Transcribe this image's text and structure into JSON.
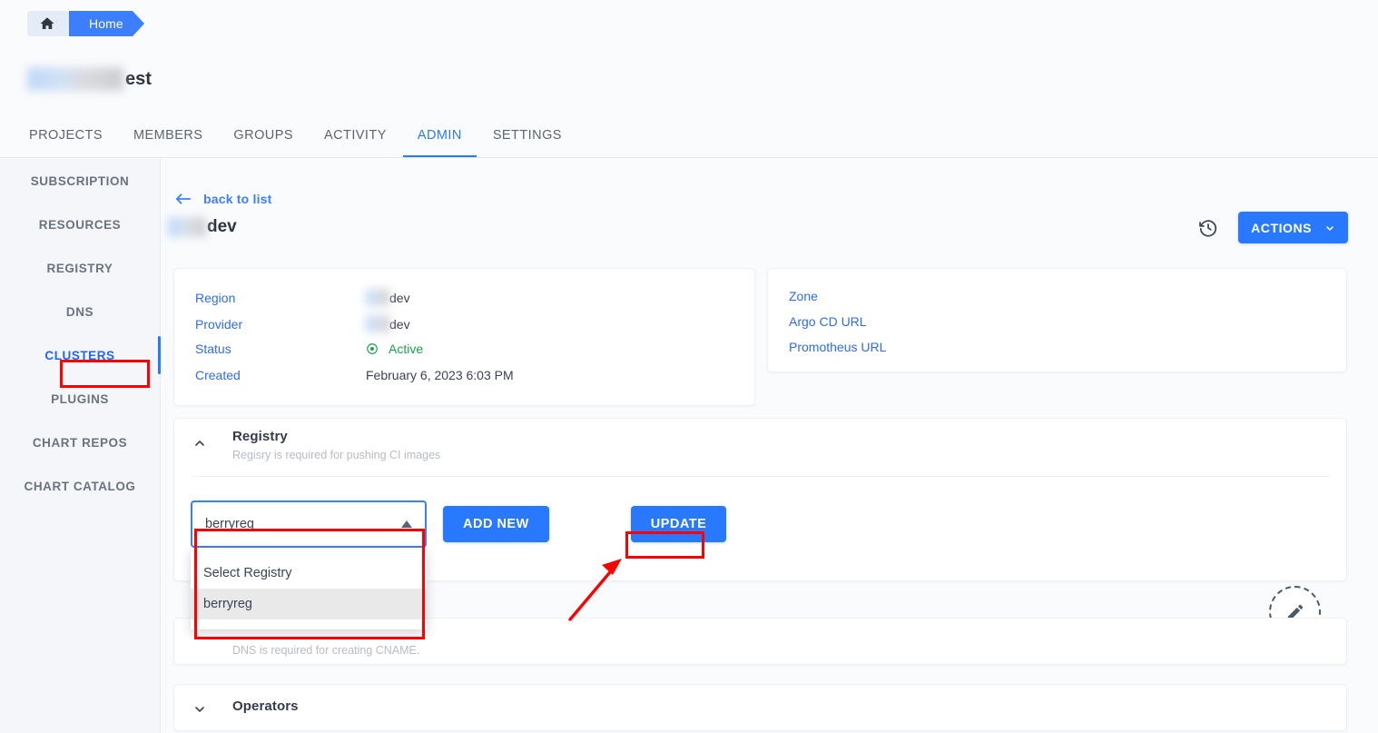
{
  "breadcrumb": {
    "home_icon": "home-icon",
    "label": "Home"
  },
  "org": {
    "title_suffix": "est",
    "redacted": true
  },
  "header": {
    "actions_label": "ACTIONS",
    "chevron": "chevron-down-icon"
  },
  "tabs": [
    {
      "label": "PROJECTS",
      "active": false
    },
    {
      "label": "MEMBERS",
      "active": false
    },
    {
      "label": "GROUPS",
      "active": false
    },
    {
      "label": "ACTIVITY",
      "active": false
    },
    {
      "label": "ADMIN",
      "active": true
    },
    {
      "label": "SETTINGS",
      "active": false
    }
  ],
  "sidebar": {
    "items": [
      {
        "label": "SUBSCRIPTION",
        "active": false
      },
      {
        "label": "RESOURCES",
        "active": false
      },
      {
        "label": "REGISTRY",
        "active": false
      },
      {
        "label": "DNS",
        "active": false
      },
      {
        "label": "CLUSTERS",
        "active": true
      },
      {
        "label": "PLUGINS",
        "active": false
      },
      {
        "label": "CHART REPOS",
        "active": false
      },
      {
        "label": "CHART CATALOG",
        "active": false
      }
    ]
  },
  "detail": {
    "back_label": "back to list",
    "back_icon": "arrow-left-icon",
    "title_suffix": "dev",
    "history_icon": "history-icon",
    "actions_label": "ACTIONS"
  },
  "info_left": {
    "rows": [
      {
        "label": "Region",
        "value": "dev",
        "redacted": true
      },
      {
        "label": "Provider",
        "value": "dev",
        "redacted": true
      },
      {
        "label": "Status",
        "value": "Active",
        "icon": "status-active-icon"
      },
      {
        "label": "Created",
        "value": "February 6, 2023 6:03 PM"
      }
    ]
  },
  "info_right": {
    "links": [
      "Zone",
      "Argo CD URL",
      "Promotheus URL"
    ]
  },
  "registry_panel": {
    "title": "Registry",
    "subtitle": "Regisry is required for pushing CI images",
    "chevron": "chevron-up-icon",
    "select": {
      "value": "berryreg",
      "caret": "caret-up-icon",
      "open": true,
      "options": [
        {
          "label": "Select Registry",
          "selected": false
        },
        {
          "label": "berryreg",
          "selected": true
        }
      ]
    },
    "add_new_label": "ADD NEW",
    "update_label": "UPDATE",
    "edit_icon": "pencil-edit-icon"
  },
  "dns_panel": {
    "subtitle": "DNS is required for creating CNAME."
  },
  "operators_panel": {
    "title": "Operators",
    "chevron": "chevron-down-icon"
  },
  "annotations": {
    "boxes": [
      "clusters-highlight",
      "registry-select-highlight",
      "update-button-highlight"
    ],
    "arrow": "red-arrow-pointing-to-update",
    "color": "#ff0000"
  },
  "colors": {
    "primary": "#2979ff",
    "link": "#2f6bf5",
    "active_tab": "#2979ff",
    "status_active": "#18a34a",
    "annotation": "#ff0000"
  }
}
